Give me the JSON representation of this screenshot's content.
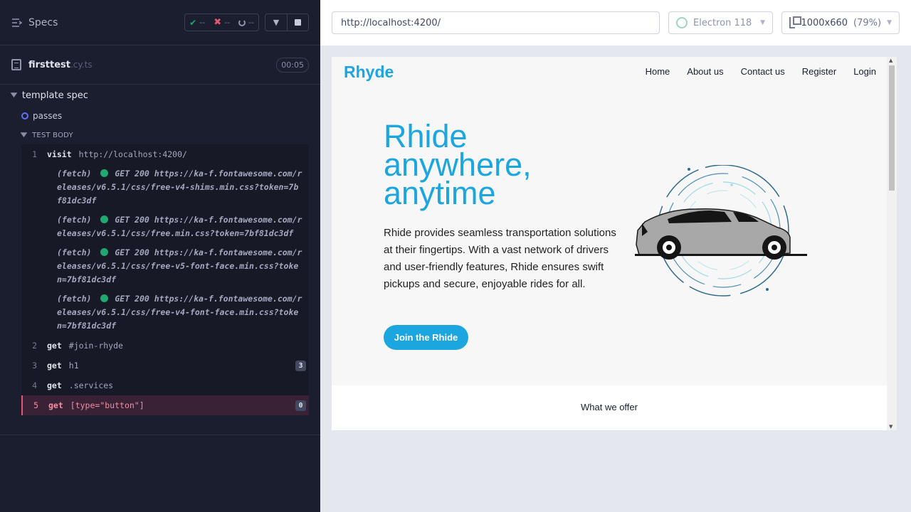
{
  "reporter": {
    "specs_label": "Specs",
    "stats": {
      "passed": "--",
      "failed": "--",
      "pending": "--"
    },
    "file": {
      "name": "firsttest",
      "ext": ".cy.ts",
      "duration": "00:05"
    },
    "suite": "template spec",
    "test": "passes",
    "body_label": "TEST BODY",
    "commands": [
      {
        "num": "1",
        "name": "visit",
        "message": "http://localhost:4200/"
      },
      {
        "num": "2",
        "name": "get",
        "message": "#join-rhyde"
      },
      {
        "num": "3",
        "name": "get",
        "message": "h1",
        "badge": "3"
      },
      {
        "num": "4",
        "name": "get",
        "message": ".services"
      },
      {
        "num": "5",
        "name": "get",
        "message": "[type=\"button\"]",
        "badge": "0"
      }
    ],
    "fetches": [
      {
        "label": "(fetch)",
        "text": "GET 200 https://ka-f.fontawesome.com/releases/v6.5.1/css/free-v4-shims.min.css?token=7bf81dc3df"
      },
      {
        "label": "(fetch)",
        "text": "GET 200 https://ka-f.fontawesome.com/releases/v6.5.1/css/free.min.css?token=7bf81dc3df"
      },
      {
        "label": "(fetch)",
        "text": "GET 200 https://ka-f.fontawesome.com/releases/v6.5.1/css/free-v5-font-face.min.css?token=7bf81dc3df"
      },
      {
        "label": "(fetch)",
        "text": "GET 200 https://ka-f.fontawesome.com/releases/v6.5.1/css/free-v4-font-face.min.css?token=7bf81dc3df"
      }
    ]
  },
  "aut": {
    "url": "http://localhost:4200/",
    "browser": "Electron 118",
    "viewport": "1000x660",
    "zoom": "(79%)"
  },
  "site": {
    "logo": "Rhyde",
    "nav": [
      "Home",
      "About us",
      "Contact us",
      "Register",
      "Login"
    ],
    "hero_title": "Rhide anywhere, anytime",
    "hero_text": "Rhide provides seamless transportation solutions at their fingertips. With a vast network of drivers and user-friendly features, Rhide ensures swift pickups and secure, enjoyable rides for all.",
    "cta": "Join the Rhide",
    "offer": "What we offer"
  },
  "colors": {
    "brand": "#1ba6e0",
    "reporter_bg": "#1b1e2e",
    "pass": "#1fa971",
    "fail": "#e45770"
  }
}
